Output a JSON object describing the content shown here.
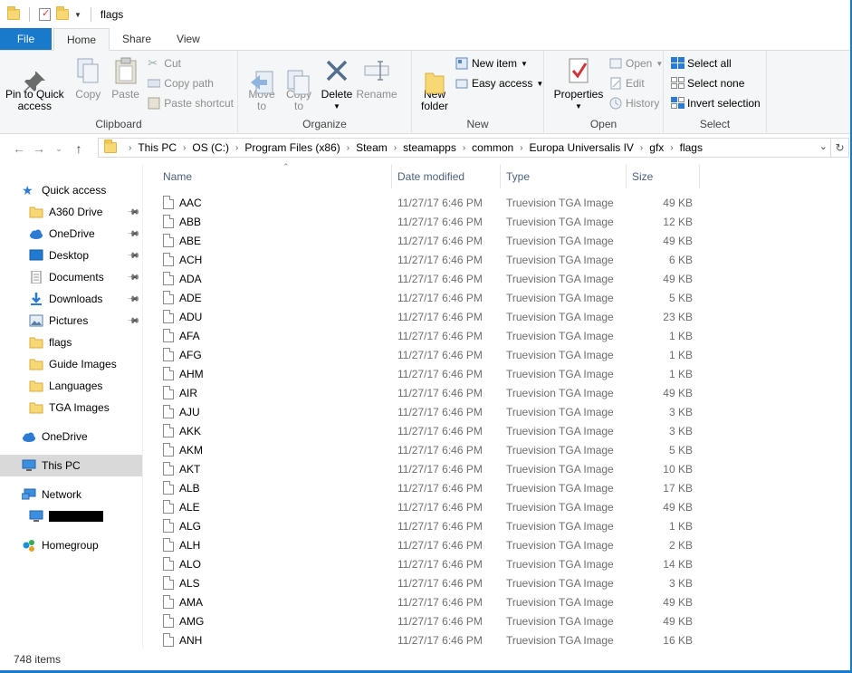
{
  "window": {
    "title": "flags"
  },
  "tabs": [
    {
      "label": "File"
    },
    {
      "label": "Home"
    },
    {
      "label": "Share"
    },
    {
      "label": "View"
    }
  ],
  "ribbon": {
    "clipboard": {
      "label": "Clipboard",
      "pin": "Pin to Quick\naccess",
      "copy": "Copy",
      "paste": "Paste",
      "cut": "Cut",
      "copy_path": "Copy path",
      "paste_shortcut": "Paste shortcut"
    },
    "organize": {
      "label": "Organize",
      "move_to": "Move\nto",
      "copy_to": "Copy\nto",
      "delete": "Delete",
      "rename": "Rename"
    },
    "new": {
      "label": "New",
      "new_folder": "New\nfolder",
      "new_item": "New item",
      "easy_access": "Easy access"
    },
    "open": {
      "label": "Open",
      "properties": "Properties",
      "open": "Open",
      "edit": "Edit",
      "history": "History"
    },
    "select": {
      "label": "Select",
      "select_all": "Select all",
      "select_none": "Select none",
      "invert": "Invert selection"
    }
  },
  "address": {
    "crumbs": [
      "This PC",
      "OS (C:)",
      "Program Files (x86)",
      "Steam",
      "steamapps",
      "common",
      "Europa Universalis IV",
      "gfx",
      "flags"
    ]
  },
  "nav": {
    "quick_access": "Quick access",
    "items": [
      "A360 Drive",
      "OneDrive",
      "Desktop",
      "Documents",
      "Downloads",
      "Pictures",
      "flags",
      "Guide Images",
      "Languages",
      "TGA Images"
    ],
    "onedrive": "OneDrive",
    "this_pc": "This PC",
    "network": "Network",
    "homegroup": "Homegroup"
  },
  "columns": {
    "name": "Name",
    "date": "Date modified",
    "type": "Type",
    "size": "Size"
  },
  "files": [
    {
      "name": "AAC",
      "date": "11/27/17 6:46 PM",
      "type": "Truevision TGA Image",
      "size": "49 KB"
    },
    {
      "name": "ABB",
      "date": "11/27/17 6:46 PM",
      "type": "Truevision TGA Image",
      "size": "12 KB"
    },
    {
      "name": "ABE",
      "date": "11/27/17 6:46 PM",
      "type": "Truevision TGA Image",
      "size": "49 KB"
    },
    {
      "name": "ACH",
      "date": "11/27/17 6:46 PM",
      "type": "Truevision TGA Image",
      "size": "6 KB"
    },
    {
      "name": "ADA",
      "date": "11/27/17 6:46 PM",
      "type": "Truevision TGA Image",
      "size": "49 KB"
    },
    {
      "name": "ADE",
      "date": "11/27/17 6:46 PM",
      "type": "Truevision TGA Image",
      "size": "5 KB"
    },
    {
      "name": "ADU",
      "date": "11/27/17 6:46 PM",
      "type": "Truevision TGA Image",
      "size": "23 KB"
    },
    {
      "name": "AFA",
      "date": "11/27/17 6:46 PM",
      "type": "Truevision TGA Image",
      "size": "1 KB"
    },
    {
      "name": "AFG",
      "date": "11/27/17 6:46 PM",
      "type": "Truevision TGA Image",
      "size": "1 KB"
    },
    {
      "name": "AHM",
      "date": "11/27/17 6:46 PM",
      "type": "Truevision TGA Image",
      "size": "1 KB"
    },
    {
      "name": "AIR",
      "date": "11/27/17 6:46 PM",
      "type": "Truevision TGA Image",
      "size": "49 KB"
    },
    {
      "name": "AJU",
      "date": "11/27/17 6:46 PM",
      "type": "Truevision TGA Image",
      "size": "3 KB"
    },
    {
      "name": "AKK",
      "date": "11/27/17 6:46 PM",
      "type": "Truevision TGA Image",
      "size": "3 KB"
    },
    {
      "name": "AKM",
      "date": "11/27/17 6:46 PM",
      "type": "Truevision TGA Image",
      "size": "5 KB"
    },
    {
      "name": "AKT",
      "date": "11/27/17 6:46 PM",
      "type": "Truevision TGA Image",
      "size": "10 KB"
    },
    {
      "name": "ALB",
      "date": "11/27/17 6:46 PM",
      "type": "Truevision TGA Image",
      "size": "17 KB"
    },
    {
      "name": "ALE",
      "date": "11/27/17 6:46 PM",
      "type": "Truevision TGA Image",
      "size": "49 KB"
    },
    {
      "name": "ALG",
      "date": "11/27/17 6:46 PM",
      "type": "Truevision TGA Image",
      "size": "1 KB"
    },
    {
      "name": "ALH",
      "date": "11/27/17 6:46 PM",
      "type": "Truevision TGA Image",
      "size": "2 KB"
    },
    {
      "name": "ALO",
      "date": "11/27/17 6:46 PM",
      "type": "Truevision TGA Image",
      "size": "14 KB"
    },
    {
      "name": "ALS",
      "date": "11/27/17 6:46 PM",
      "type": "Truevision TGA Image",
      "size": "3 KB"
    },
    {
      "name": "AMA",
      "date": "11/27/17 6:46 PM",
      "type": "Truevision TGA Image",
      "size": "49 KB"
    },
    {
      "name": "AMG",
      "date": "11/27/17 6:46 PM",
      "type": "Truevision TGA Image",
      "size": "49 KB"
    },
    {
      "name": "ANH",
      "date": "11/27/17 6:46 PM",
      "type": "Truevision TGA Image",
      "size": "16 KB"
    }
  ],
  "status": {
    "count": "748 items"
  },
  "colors": {
    "accent": "#1979ca",
    "folder": "#f8d775",
    "header_text": "#4c607a"
  }
}
